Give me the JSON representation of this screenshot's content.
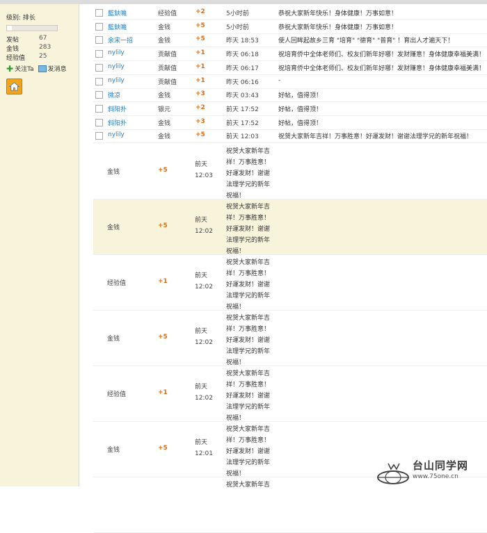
{
  "sidebar": {
    "rank_label": "级别: 排长",
    "progress": 0.1,
    "stats": [
      {
        "label": "发帖",
        "value": "67"
      },
      {
        "label": "金钱",
        "value": "283"
      },
      {
        "label": "经验值",
        "value": "25"
      }
    ],
    "follow_label": "关注Ta",
    "message_label": "发消息"
  },
  "rows": [
    {
      "user": "藍鈇嘰",
      "type": "经验值",
      "amount": "+2",
      "time": "5小时前",
      "reason": "恭祝大家新年快乐！身体健康！万事如意！"
    },
    {
      "user": "藍鈇嘰",
      "type": "金钱",
      "amount": "+5",
      "time": "5小时前",
      "reason": "恭祝大家新年快乐！身体健康！万事如意！"
    },
    {
      "user": "余宋一招",
      "type": "金钱",
      "amount": "+5",
      "time": "昨天 18:53",
      "reason": "使人回眸起故乡三育 \"培育\" \"德育\" \"普育\" ！育出人才遍天下！"
    },
    {
      "user": "nylily",
      "type": "贡献值",
      "amount": "+1",
      "time": "昨天 06:18",
      "reason": "祝培育侨中全体老师们、校友们新年好哪！发财赚意！身体健康幸福美满！"
    },
    {
      "user": "nylily",
      "type": "贡献值",
      "amount": "+1",
      "time": "昨天 06:17",
      "reason": "祝培育侨中全体老师们、校友们新年好哪！发财赚意！身体健康幸福美满！"
    },
    {
      "user": "nylily",
      "type": "贡献值",
      "amount": "+1",
      "time": "昨天 06:16",
      "reason": "-"
    },
    {
      "user": "微凉",
      "type": "金钱",
      "amount": "+3",
      "time": "昨天 03:43",
      "reason": "好帖，值得顶！"
    },
    {
      "user": "斜阳扑",
      "type": "银元",
      "amount": "+2",
      "time": "前天 17:52",
      "reason": "好帖，值得顶！"
    },
    {
      "user": "斜阳扑",
      "type": "金钱",
      "amount": "+3",
      "time": "前天 17:52",
      "reason": "好帖，值得顶！"
    },
    {
      "user": "nylily",
      "type": "金钱",
      "amount": "+5",
      "time": "前天 12:03",
      "reason": "祝贺大家新年吉祥！万事胜意！好運发财！谢谢法理学兄的新年祝福！"
    }
  ],
  "wide_rows": [
    {
      "type": "金钱",
      "amount": "+5",
      "time": "前天 12:03",
      "reason": "祝贺大家新年吉祥！万事胜意！好運发财！谢谢法理学兄的新年祝福！"
    },
    {
      "type": "金钱",
      "amount": "+5",
      "time": "前天 12:02",
      "reason": "祝贺大家新年吉祥！万事胜意！好運发财！谢谢法理学兄的新年祝福！"
    },
    {
      "type": "经验值",
      "amount": "+1",
      "time": "前天 12:02",
      "reason": "祝贺大家新年吉祥！万事胜意！好運发财！谢谢法理学兄的新年祝福！"
    },
    {
      "type": "金钱",
      "amount": "+5",
      "time": "前天 12:02",
      "reason": "祝贺大家新年吉祥！万事胜意！好運发财！谢谢法理学兄的新年祝福！"
    },
    {
      "type": "经验值",
      "amount": "+1",
      "time": "前天 12:02",
      "reason": "祝贺大家新年吉祥！万事胜意！好運发财！谢谢法理学兄的新年祝福！"
    },
    {
      "type": "金钱",
      "amount": "+5",
      "time": "前天 12:01",
      "reason": "祝贺大家新年吉祥！万事胜意！好運发财！谢谢法理学兄的新年祝福！"
    },
    {
      "type": "",
      "amount": "",
      "time": "",
      "reason": "祝贺大家新年吉"
    }
  ],
  "watermark": {
    "text": "台山同学网",
    "url": "www.75one.cn"
  }
}
